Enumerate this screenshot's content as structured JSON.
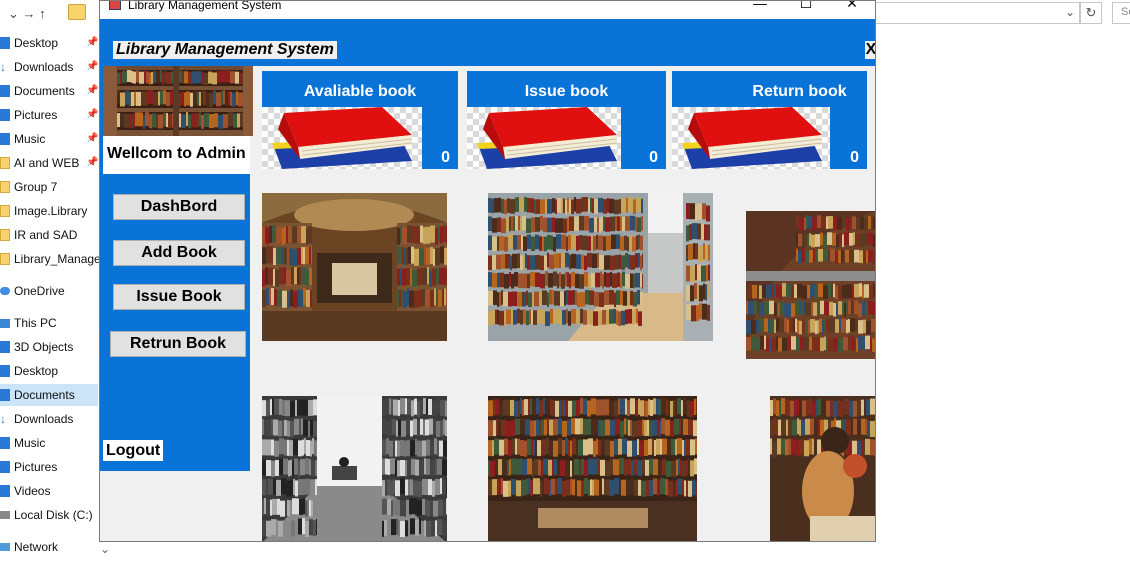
{
  "explorer": {
    "nav_arrows": "⌄  →  ↑",
    "search_hint": "Se",
    "nav_items": [
      {
        "label": "Desktop",
        "icon": "desktop-icon",
        "pinned": true
      },
      {
        "label": "Downloads",
        "icon": "downloads-icon",
        "pinned": true
      },
      {
        "label": "Documents",
        "icon": "documents-icon",
        "pinned": true
      },
      {
        "label": "Pictures",
        "icon": "pictures-icon",
        "pinned": true
      },
      {
        "label": "Music",
        "icon": "music-icon",
        "pinned": true
      },
      {
        "label": "AI and WEB",
        "icon": "folder-icon",
        "pinned": true
      },
      {
        "label": "Group 7",
        "icon": "folder-icon",
        "pinned": false
      },
      {
        "label": "Image.Library",
        "icon": "folder-icon",
        "pinned": false
      },
      {
        "label": "IR and SAD",
        "icon": "folder-icon",
        "pinned": false
      },
      {
        "label": "Library_Manage",
        "icon": "folder-icon",
        "pinned": false
      },
      {
        "label": "OneDrive",
        "icon": "onedrive-icon",
        "pinned": false
      },
      {
        "label": "This PC",
        "icon": "this-pc-icon",
        "pinned": false
      },
      {
        "label": "3D Objects",
        "icon": "3d-objects-icon",
        "pinned": false
      },
      {
        "label": "Desktop",
        "icon": "desktop-icon",
        "pinned": false
      },
      {
        "label": "Documents",
        "icon": "documents-icon",
        "pinned": false
      },
      {
        "label": "Downloads",
        "icon": "downloads-icon",
        "pinned": false
      },
      {
        "label": "Music",
        "icon": "music-icon",
        "pinned": false
      },
      {
        "label": "Pictures",
        "icon": "pictures-icon",
        "pinned": false
      },
      {
        "label": "Videos",
        "icon": "videos-icon",
        "pinned": false
      },
      {
        "label": "Local Disk (C:)",
        "icon": "disk-icon",
        "pinned": false
      },
      {
        "label": "Network",
        "icon": "network-icon",
        "pinned": false
      }
    ]
  },
  "window": {
    "title": "Library Management System",
    "minimize": "—",
    "maximize": "☐",
    "close": "✕"
  },
  "app": {
    "heading": "Library Management System",
    "close_label": "X",
    "welcome": "Wellcom to Admin",
    "menu": {
      "dashboard": "DashBord",
      "add_book": "Add Book",
      "issue_book": "Issue Book",
      "return_book": "Retrun Book",
      "logout": "Logout"
    },
    "cards": [
      {
        "title": "Avaliable book",
        "count": "0"
      },
      {
        "title": "Issue book",
        "count": "0"
      },
      {
        "title": "Return book",
        "count": "0"
      }
    ]
  },
  "colors": {
    "accent": "#0a73d8",
    "window_bg": "#f0f0f0",
    "button_bg": "#e1e1e1",
    "selected_nav": "#cce4f7"
  }
}
